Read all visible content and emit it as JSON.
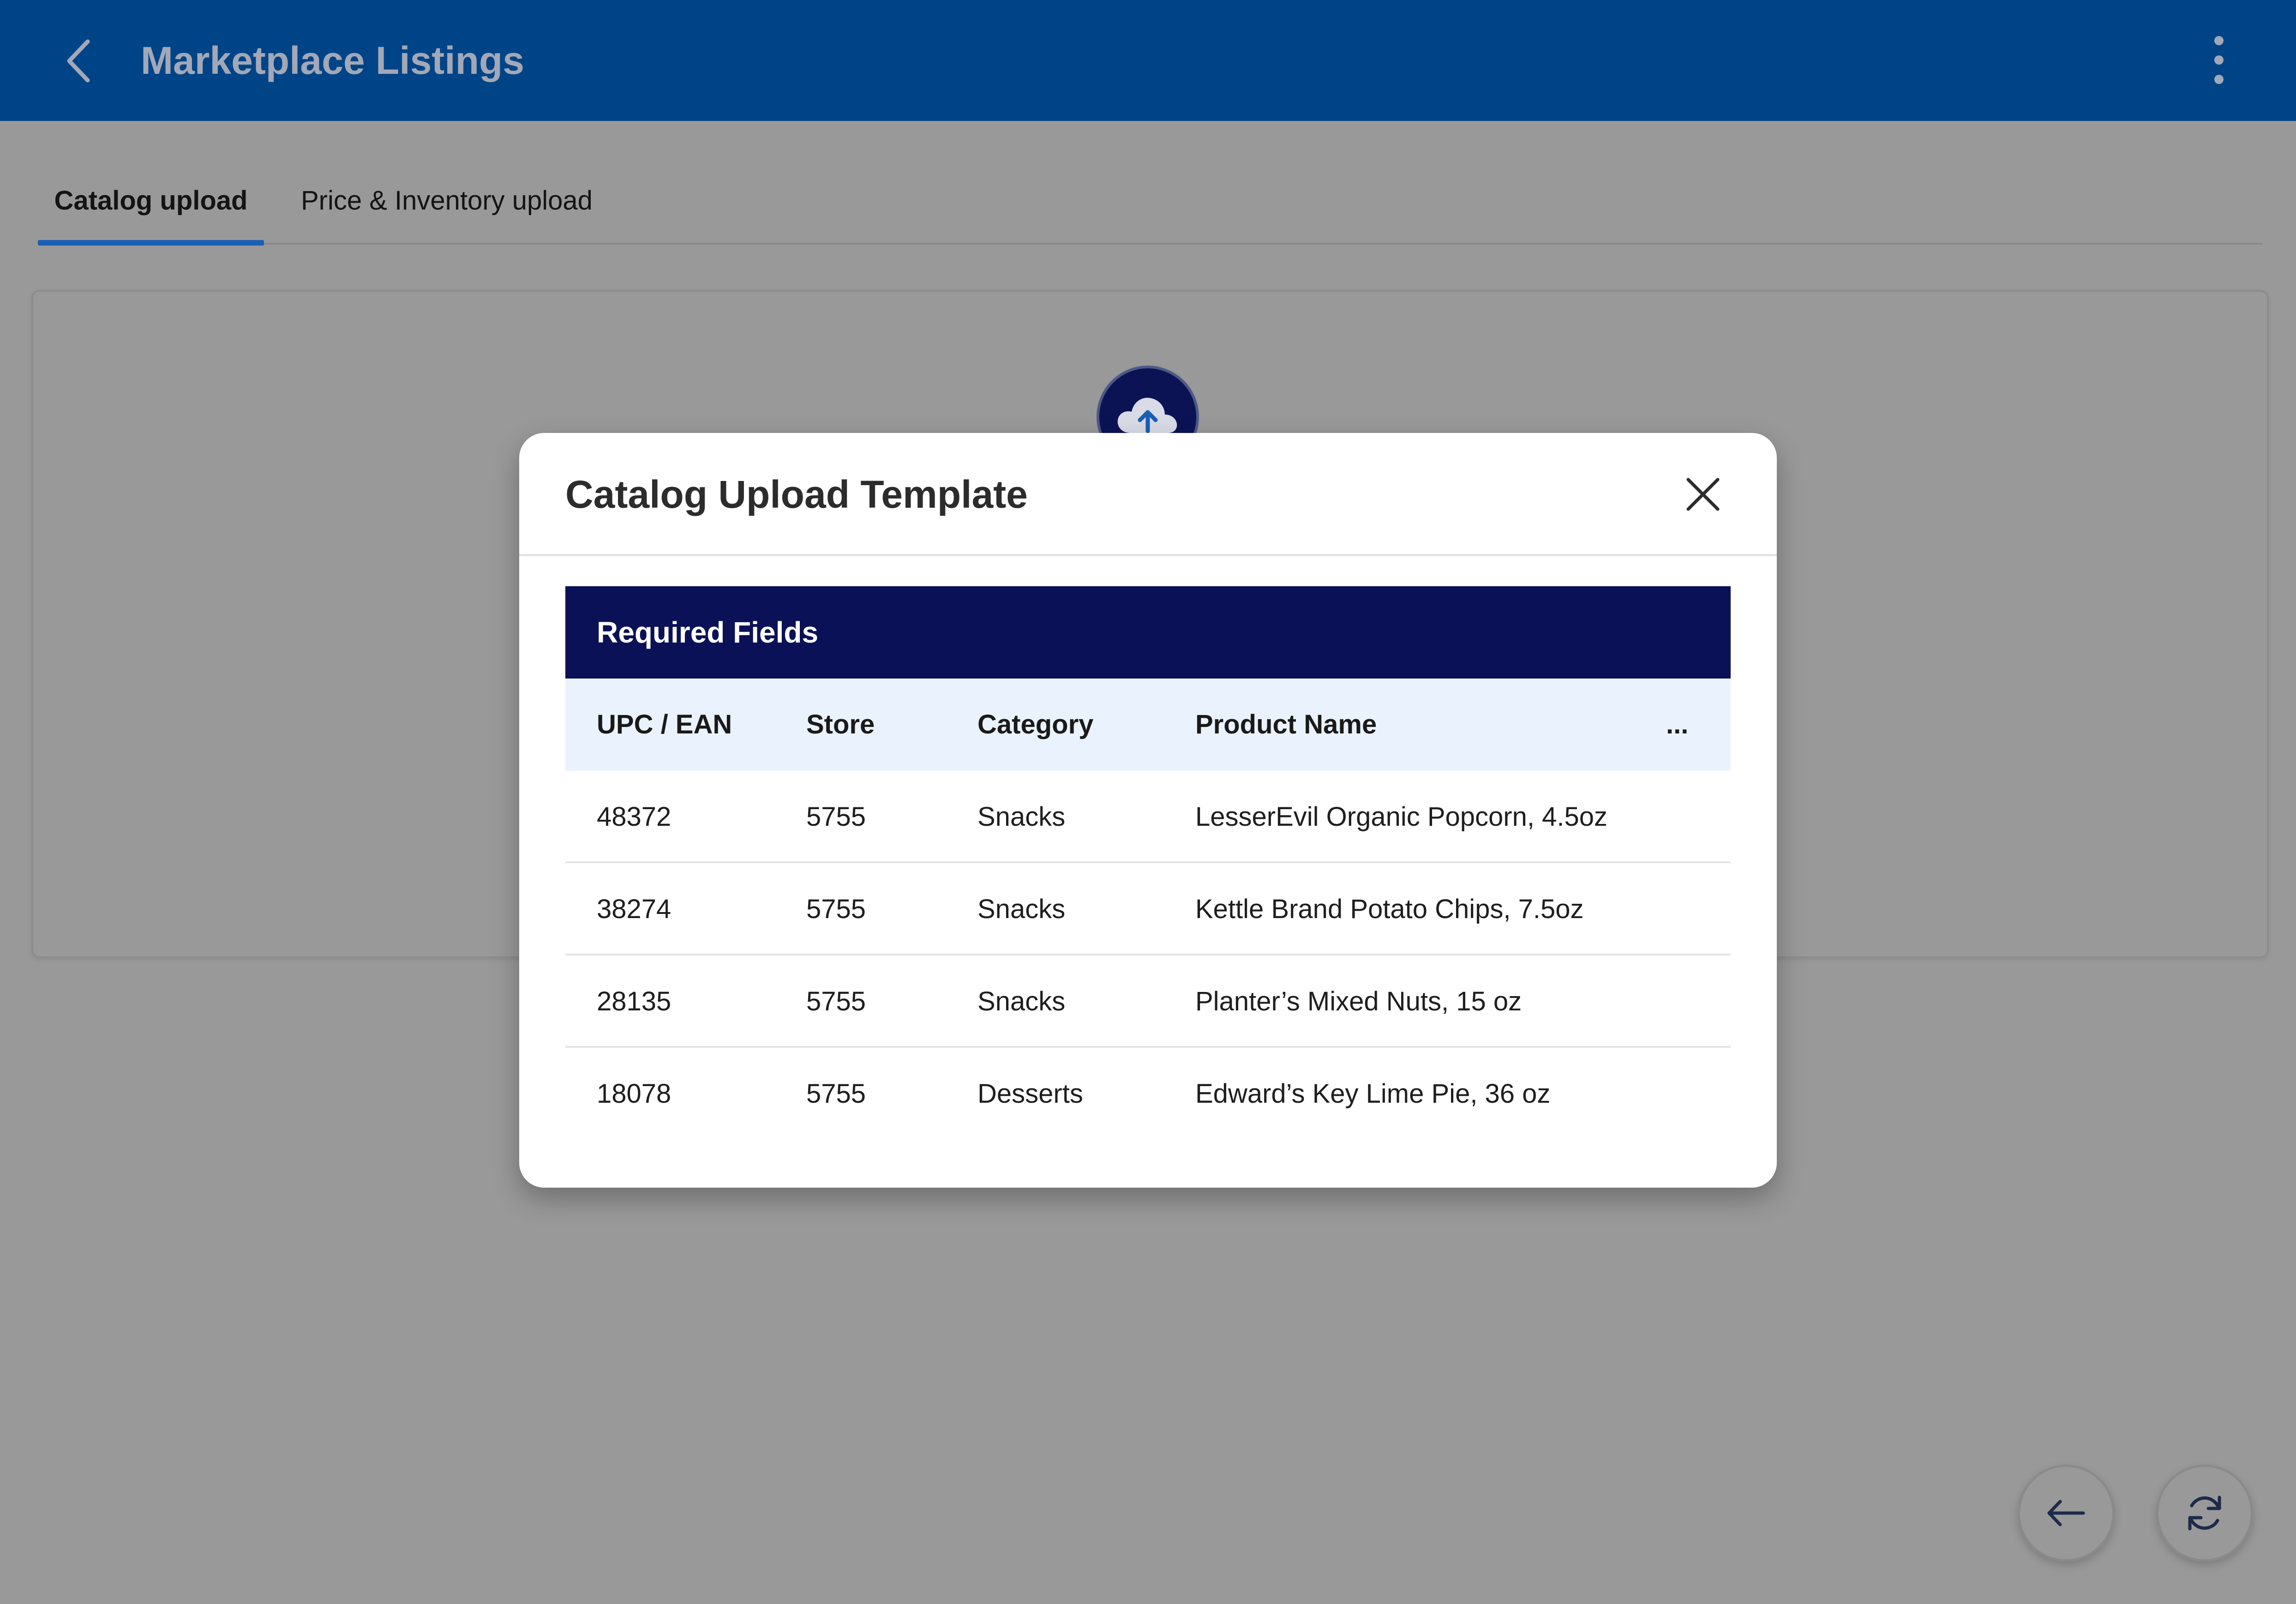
{
  "header": {
    "title": "Marketplace Listings",
    "back_icon": "chevron-left-icon",
    "menu_icon": "kebab-menu-icon",
    "background_color": "#004488"
  },
  "tabs": [
    {
      "label": "Catalog upload",
      "active": true
    },
    {
      "label": "Price & Inventory upload",
      "active": false
    }
  ],
  "upload_card": {
    "icon": "cloud-upload-icon"
  },
  "modal": {
    "title": "Catalog Upload Template",
    "close_icon": "close-icon",
    "table": {
      "banner": "Required Fields",
      "banner_color": "#0b1157",
      "columns": [
        "UPC / EAN",
        "Store",
        "Category",
        "Product Name",
        "..."
      ],
      "rows": [
        [
          "48372",
          "5755",
          "Snacks",
          "LesserEvil Organic Popcorn, 4.5oz"
        ],
        [
          "38274",
          "5755",
          "Snacks",
          "Kettle Brand Potato Chips, 7.5oz"
        ],
        [
          "28135",
          "5755",
          "Snacks",
          "Planter’s Mixed Nuts, 15 oz"
        ],
        [
          "18078",
          "5755",
          "Desserts",
          "Edward’s Key Lime Pie, 36 oz"
        ]
      ]
    }
  },
  "fabs": {
    "back_icon": "arrow-left-icon",
    "refresh_icon": "refresh-icon"
  },
  "colors": {
    "accent": "#1a5fb4",
    "overlay_background": "#999999"
  }
}
